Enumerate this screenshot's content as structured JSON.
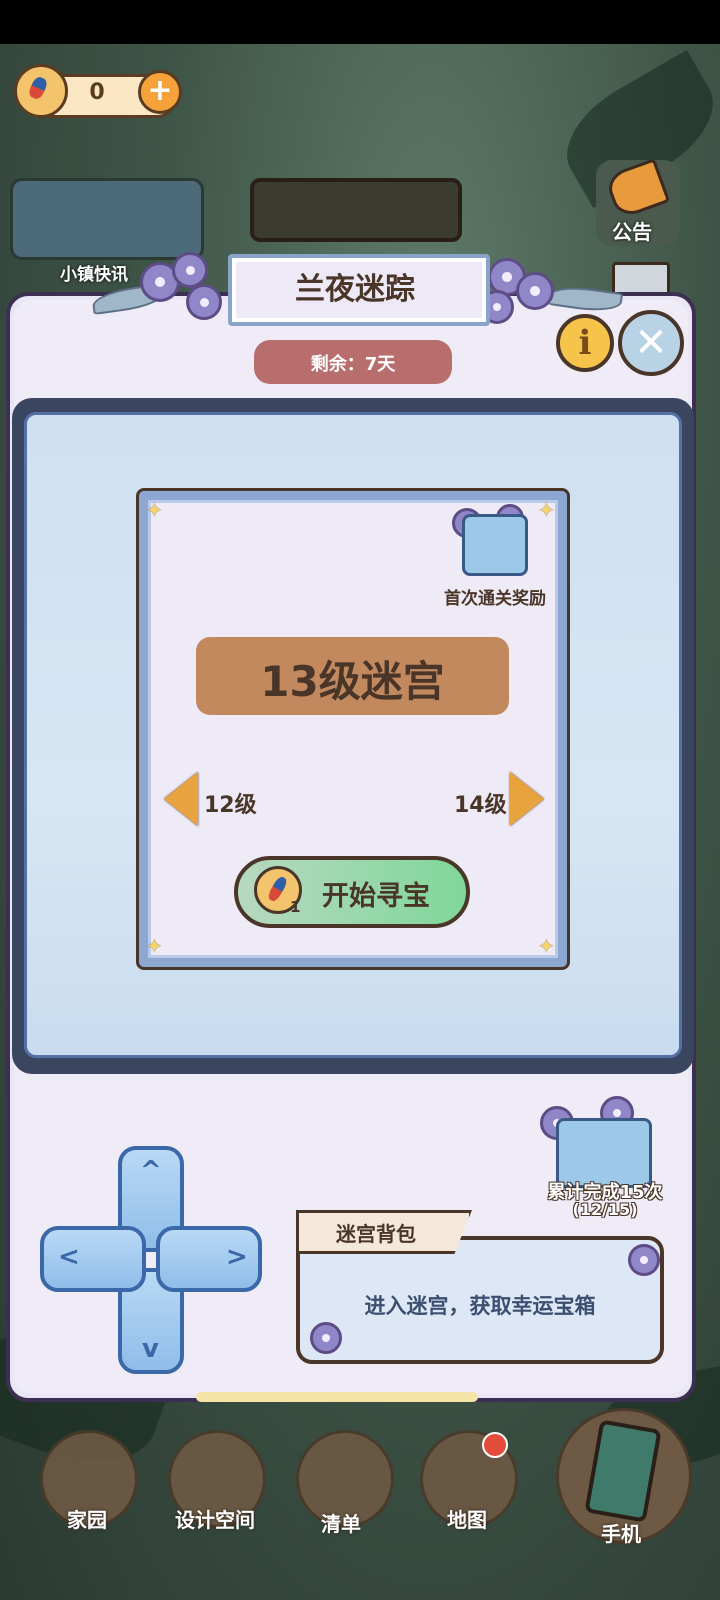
{
  "currency": {
    "value": "0",
    "add_label": "+"
  },
  "hud": {
    "town_event_label": "小镇快讯",
    "notice_label": "公告"
  },
  "event": {
    "title": "兰夜迷踪",
    "remaining": "剩余：7天",
    "info_label": "i",
    "close_label": "✕"
  },
  "maze": {
    "level_title": "13级迷宫",
    "first_clear_reward_label": "首次通关奖励",
    "prev_level_label": "12级",
    "next_level_label": "14级",
    "start_label": "开始寻宝",
    "start_cost": "1"
  },
  "cumulative_reward": {
    "label": "累计完成15次",
    "progress": "(12/15)"
  },
  "backpack": {
    "title": "迷宫背包",
    "description": "进入迷宫，获取幸运宝箱"
  },
  "dpad": {
    "up": "^",
    "down": "v",
    "left": "<",
    "right": ">"
  },
  "nav": {
    "home": "家园",
    "design": "设计空间",
    "list": "清单",
    "map": "地图",
    "phone": "手机"
  },
  "colors": {
    "panel_bg": "#e9e6f6",
    "board_border": "#3a4660",
    "level_plate": "#c2895e",
    "start_button": "#7fd79a",
    "timer_pill": "#b96e6e",
    "text_brown": "#4a3628"
  },
  "icons": [
    "compass-icon",
    "plus-icon",
    "megaphone-icon",
    "mail-icon",
    "info-icon",
    "close-icon",
    "gift-chest-icon",
    "arrow-left-icon",
    "arrow-right-icon",
    "home-icon",
    "design-icon",
    "list-icon",
    "map-pin-icon",
    "phone-icon"
  ]
}
